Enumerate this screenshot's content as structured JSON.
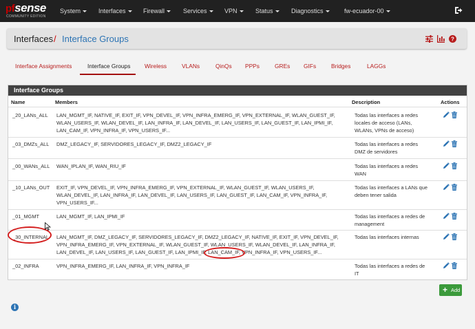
{
  "brand": {
    "logo_text_pf": "pf",
    "logo_text_sense": "sense",
    "edition": "COMMUNITY EDITION"
  },
  "nav": {
    "items": [
      {
        "label": "System"
      },
      {
        "label": "Interfaces"
      },
      {
        "label": "Firewall"
      },
      {
        "label": "Services"
      },
      {
        "label": "VPN"
      },
      {
        "label": "Status"
      },
      {
        "label": "Diagnostics"
      },
      {
        "label": "fw-ecuador-00"
      }
    ],
    "logout_icon": "sign-out-icon"
  },
  "breadcrumb": {
    "parent": "Interfaces",
    "separator": "/",
    "current": "Interface Groups"
  },
  "header_icons": [
    "sliders-icon",
    "bar-chart-icon",
    "help-icon"
  ],
  "tabs": [
    {
      "label": "Interface Assignments"
    },
    {
      "label": "Interface Groups",
      "active": true
    },
    {
      "label": "Wireless"
    },
    {
      "label": "VLANs"
    },
    {
      "label": "QinQs"
    },
    {
      "label": "PPPs"
    },
    {
      "label": "GREs"
    },
    {
      "label": "GIFs"
    },
    {
      "label": "Bridges"
    },
    {
      "label": "LAGGs"
    }
  ],
  "panel": {
    "title": "Interface Groups",
    "columns": {
      "name": "Name",
      "members": "Members",
      "description": "Description",
      "actions": "Actions"
    },
    "rows": [
      {
        "name": "_20_LANs_ALL",
        "members": [
          "LAN_MGMT_IF, NATIVE_IF, EXIT_IF, VPN_DEVEL_IF, VPN_INFRA_EMERG_IF, VPN_EXTERNAL_IF, WLAN_GUEST_IF,",
          "WLAN_USERS_IF, WLAN_DEVEL_IF, LAN_INFRA_IF, LAN_DEVEL_IF, LAN_USERS_IF, LAN_GUEST_IF, LAN_IPMI_IF,",
          "LAN_CAM_IF, VPN_INFRA_IF, VPN_USERS_IF..."
        ],
        "description": [
          "Todas las interfaces a redes",
          "locales de acceso (LANs,",
          "WLANs, VPNs de acceso)"
        ]
      },
      {
        "name": "_03_DMZs_ALL",
        "members": [
          "DMZ_LEGACY_IF, SERVIDORES_LEGACY_IF, DMZ2_LEGACY_IF"
        ],
        "description": [
          "Todas las interfaces a redes",
          "DMZ de servidores"
        ]
      },
      {
        "name": "_00_WANs_ALL",
        "members": [
          "WAN_IPLAN_IF, WAN_RIU_IF"
        ],
        "description": [
          "Todas las interfaces a redes",
          "WAN"
        ]
      },
      {
        "name": "_10_LANs_OUT",
        "members": [
          "EXIT_IF, VPN_DEVEL_IF, VPN_INFRA_EMERG_IF, VPN_EXTERNAL_IF, WLAN_GUEST_IF, WLAN_USERS_IF,",
          "WLAN_DEVEL_IF, LAN_INFRA_IF, LAN_DEVEL_IF, LAN_USERS_IF, LAN_GUEST_IF, LAN_CAM_IF, VPN_INFRA_IF,",
          "VPN_USERS_IF..."
        ],
        "description": [
          "Todas las interfaces a LANs que",
          "deben tener salida"
        ]
      },
      {
        "name": "_01_MGMT",
        "members": [
          "LAN_MGMT_IF, LAN_IPMI_IF"
        ],
        "description": [
          "Todas las interfaces a redes de",
          "management"
        ]
      },
      {
        "name": "_30_INTERNAL",
        "members": [
          "LAN_MGMT_IF, DMZ_LEGACY_IF, SERVIDORES_LEGACY_IF, DMZ2_LEGACY_IF, NATIVE_IF, EXIT_IF, VPN_DEVEL_IF,",
          "VPN_INFRA_EMERG_IF, VPN_EXTERNAL_IF, WLAN_GUEST_IF, WLAN_USERS_IF, WLAN_DEVEL_IF, LAN_INFRA_IF,",
          "LAN_DEVEL_IF, LAN_USERS_IF, LAN_GUEST_IF, LAN_IPMI_IF, LAN_CAM_IF, VPN_INFRA_IF, VPN_USERS_IF..."
        ],
        "description": [
          "Todas las interfaces internas"
        ]
      },
      {
        "name": "_02_INFRA",
        "members": [
          "VPN_INFRA_EMERG_IF, LAN_INFRA_IF, VPN_INFRA_IF"
        ],
        "description": [
          "Todas las interfaces a redes de",
          "IT"
        ]
      }
    ],
    "row_actions": [
      "edit-pencil-icon",
      "trash-icon"
    ]
  },
  "add_button": {
    "label": "Add",
    "icon": "plus-icon"
  },
  "colors": {
    "topbar": "#212121",
    "accent_red": "#b71c1c",
    "link_blue": "#2d74b4",
    "add_green": "#3b9a3b",
    "annotation_red": "#d42020"
  }
}
